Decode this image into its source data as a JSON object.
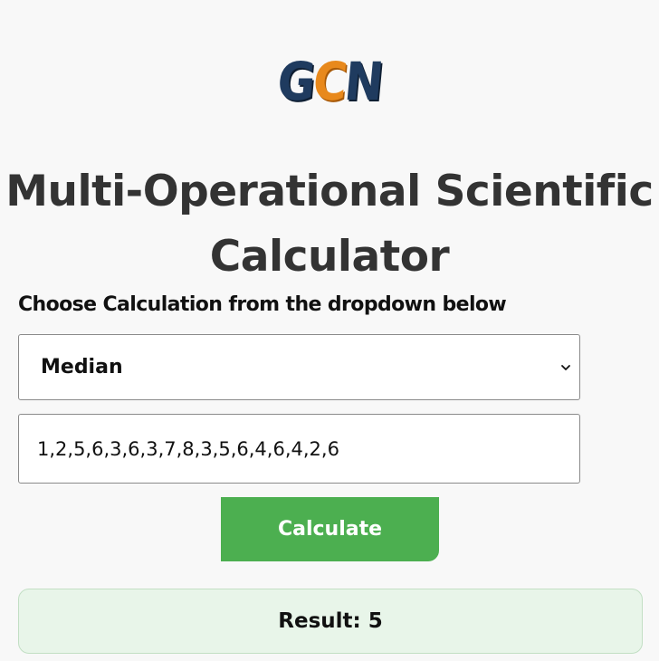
{
  "logo": {
    "letters": [
      "G",
      "C",
      "N"
    ]
  },
  "page": {
    "title": "Multi-Operational Scientific Calculator",
    "instruction": "Choose Calculation from the dropdown below"
  },
  "calculation_select": {
    "selected": "Median",
    "icon": "chevron-down-icon"
  },
  "numbers_input": {
    "value": "1,2,5,6,3,6,3,7,8,3,5,6,4,6,4,2,6"
  },
  "calculate_button": {
    "label": "Calculate"
  },
  "result": {
    "text": "Result: 5"
  },
  "colors": {
    "logo_blue": "#1f3b5f",
    "logo_orange": "#e8891c",
    "button_green": "#4caf50",
    "result_background": "#e8f5e9",
    "page_background": "#f8f8f8"
  }
}
